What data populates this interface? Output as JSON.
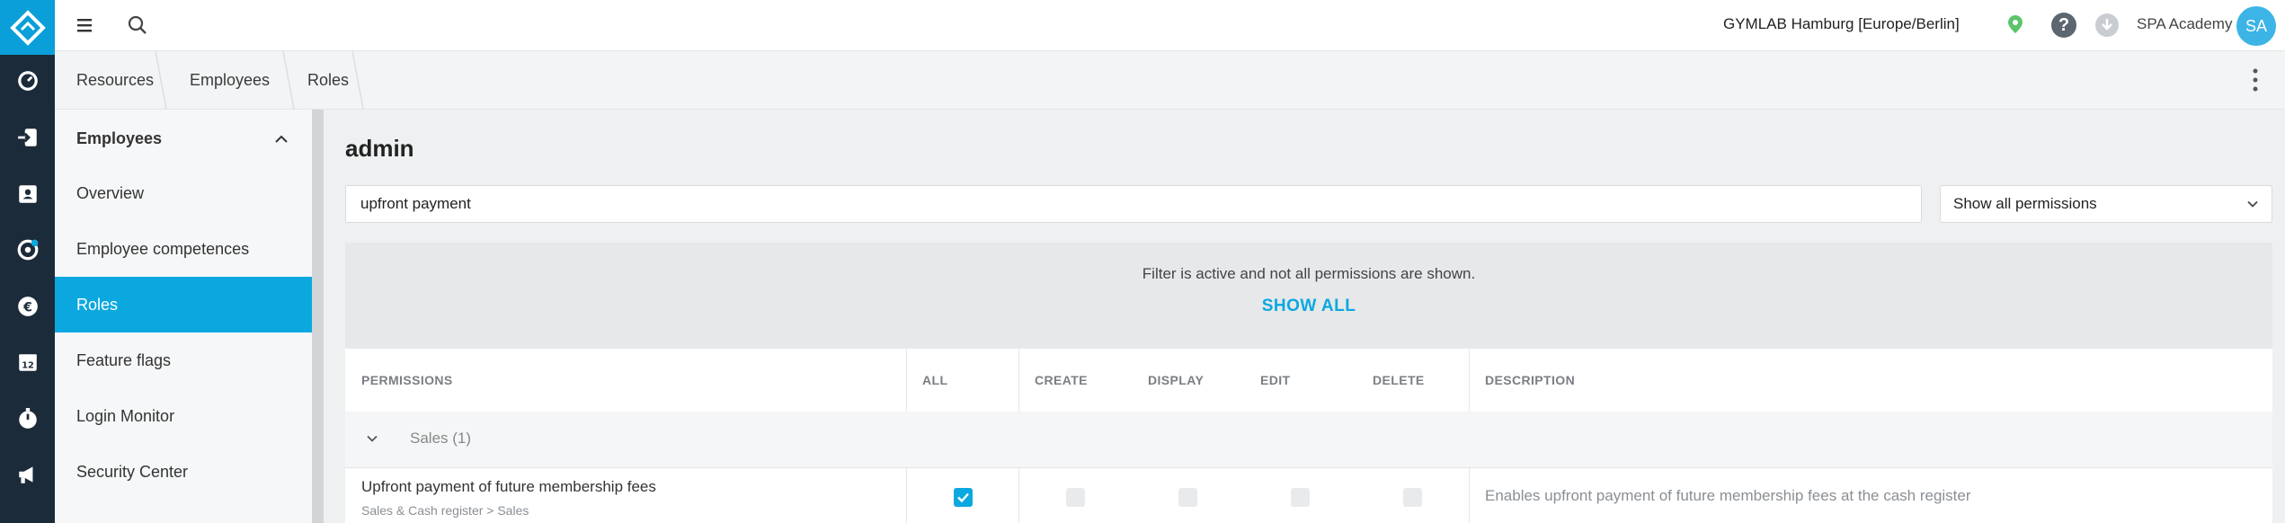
{
  "topbar": {
    "location": "GYMLAB Hamburg [Europe/Berlin]",
    "help_label": "?",
    "user_name": "SPA Academy",
    "user_initials": "SA"
  },
  "breadcrumb": [
    "Resources",
    "Employees",
    "Roles"
  ],
  "sidebar": {
    "section": "Employees",
    "items": [
      {
        "label": "Overview",
        "active": false
      },
      {
        "label": "Employee competences",
        "active": false
      },
      {
        "label": "Roles",
        "active": true
      },
      {
        "label": "Feature flags",
        "active": false
      },
      {
        "label": "Login Monitor",
        "active": false
      },
      {
        "label": "Security Center",
        "active": false
      }
    ]
  },
  "main": {
    "title": "admin",
    "search_value": "upfront payment",
    "filter_select": "Show all permissions",
    "filter_notice": "Filter is active and not all permissions are shown.",
    "show_all_label": "SHOW ALL"
  },
  "table": {
    "columns": [
      "PERMISSIONS",
      "ALL",
      "CREATE",
      "DISPLAY",
      "EDIT",
      "DELETE",
      "DESCRIPTION"
    ],
    "group": "Sales (1)",
    "rows": [
      {
        "name": "Upfront payment of future membership fees",
        "path": "Sales & Cash register > Sales",
        "all": true,
        "create": false,
        "display": false,
        "edit": false,
        "delete": false,
        "description": "Enables upfront payment of future membership fees at the cash register"
      }
    ]
  },
  "colors": {
    "accent": "#0ba8e0",
    "rail": "#1c2b3a",
    "logo": "#0a9fd8",
    "location_pin": "#5cc46a",
    "avatar": "#3cb4e6"
  },
  "icons": {
    "rail": [
      "logo-icon",
      "dashboard-icon",
      "checkin-icon",
      "contacts-icon",
      "settings-icon",
      "finance-icon",
      "calendar-icon",
      "stopwatch-icon",
      "marketing-icon"
    ],
    "topbar": [
      "menu-icon",
      "search-icon",
      "location-pin-icon",
      "help-icon",
      "download-icon"
    ]
  }
}
